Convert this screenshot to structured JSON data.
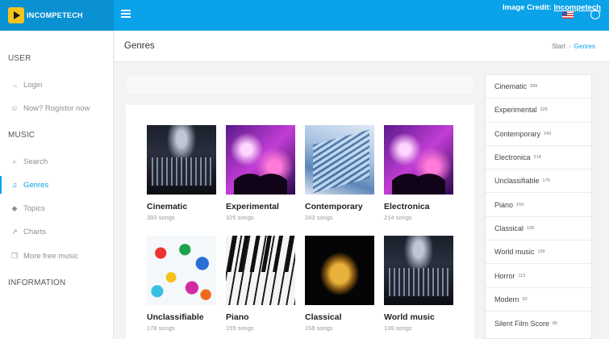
{
  "header": {
    "logo_text": "INCOMPETECH",
    "credit_prefix": "Image Credit: ",
    "credit_link": "Incompetech"
  },
  "sidebar": {
    "sections": [
      {
        "title": "USER",
        "items": [
          {
            "label": "Login",
            "icon": "login-icon"
          },
          {
            "label": "Now? Rogistor now",
            "icon": "add-user-icon"
          }
        ]
      },
      {
        "title": "MUSIC",
        "items": [
          {
            "label": "Search",
            "icon": "search-icon"
          },
          {
            "label": "Genres",
            "icon": "music-note-icon",
            "active": true
          },
          {
            "label": "Topics",
            "icon": "tag-icon"
          },
          {
            "label": "Charts",
            "icon": "chart-line-icon"
          },
          {
            "label": "More free music",
            "icon": "external-link-icon"
          }
        ]
      },
      {
        "title": "INFORMATION",
        "items": []
      }
    ]
  },
  "page": {
    "title": "Genres",
    "breadcrumb": [
      "Start",
      "Genres"
    ]
  },
  "cards": [
    {
      "name": "Cinematic",
      "count": "393 songs",
      "thumb": "orchestra-image"
    },
    {
      "name": "Experimental",
      "count": "325 songs",
      "thumb": "concert-crowd-image"
    },
    {
      "name": "Contemporary",
      "count": "243 songs",
      "thumb": "modern-building-image"
    },
    {
      "name": "Electronica",
      "count": "214 songs",
      "thumb": "concert-crowd-image"
    },
    {
      "name": "Unclassifiable",
      "count": "178 songs",
      "thumb": "paint-splash-image"
    },
    {
      "name": "Piano",
      "count": "159 songs",
      "thumb": "piano-keys-image"
    },
    {
      "name": "Classical",
      "count": "158 songs",
      "thumb": "golden-statue-image"
    },
    {
      "name": "World music",
      "count": "139 songs",
      "thumb": "orchestra-image"
    }
  ],
  "genre_list": [
    {
      "name": "Cinematic",
      "count": "399"
    },
    {
      "name": "Experimental",
      "count": "325"
    },
    {
      "name": "Contemporary",
      "count": "243"
    },
    {
      "name": "Electronica",
      "count": "214"
    },
    {
      "name": "Unclassifiable",
      "count": "179"
    },
    {
      "name": "Piano",
      "count": "159"
    },
    {
      "name": "Classical",
      "count": "158"
    },
    {
      "name": "World music",
      "count": "139"
    },
    {
      "name": "Horror",
      "count": "113"
    },
    {
      "name": "Modern",
      "count": "93"
    },
    {
      "name": "Silent Film Score",
      "count": "85"
    }
  ]
}
